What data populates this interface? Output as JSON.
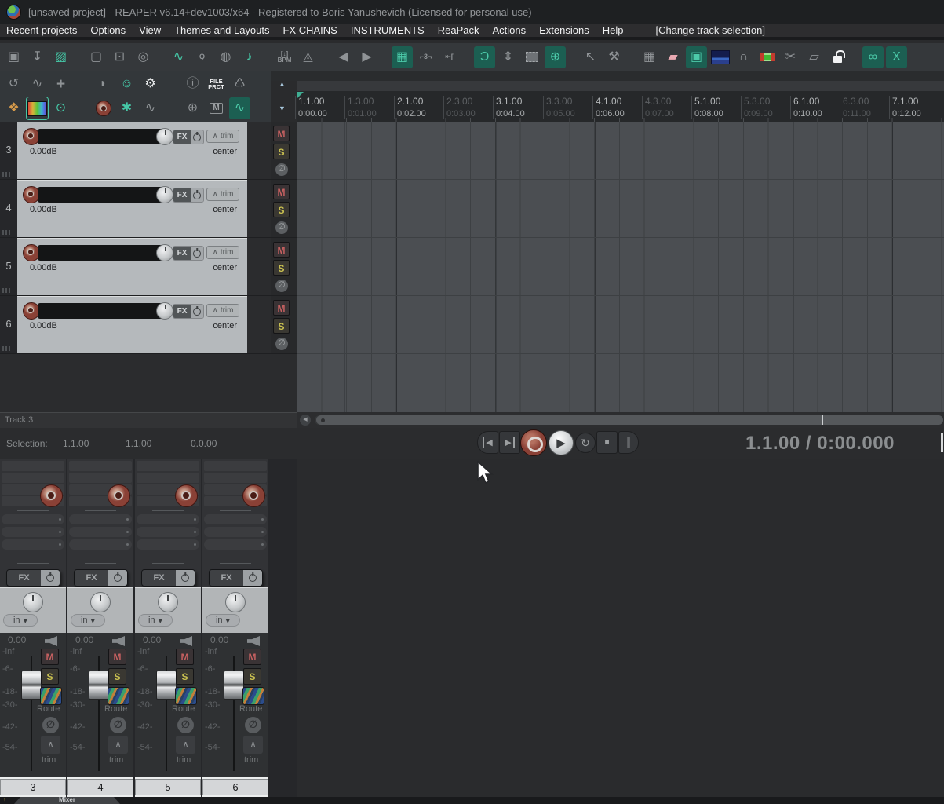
{
  "title_bar": {
    "app_icon": "reaper-logo",
    "title": "[unsaved project] - REAPER v6.14+dev1003/x64 - Registered to Boris Yanushevich (Licensed for personal use)"
  },
  "menu": {
    "items": [
      "Recent projects",
      "Options",
      "View",
      "Themes and Layouts",
      "FX CHAINS",
      "INSTRUMENTS",
      "ReaPack",
      "Actions",
      "Extensions",
      "Help"
    ],
    "extra": "[Change track selection]"
  },
  "toolbar": {
    "buttons": [
      {
        "name": "save-project",
        "glyph": "▣",
        "active": false
      },
      {
        "name": "render",
        "glyph": "↧",
        "active": false
      },
      {
        "name": "open-project",
        "glyph": "▨",
        "active": false
      },
      {
        "name": "new-project",
        "glyph": "▢",
        "active": false
      },
      {
        "name": "project-settings",
        "glyph": "⊡",
        "active": false
      },
      {
        "name": "find",
        "glyph": "◎",
        "active": false
      },
      {
        "name": "media-explorer",
        "glyph": "∿",
        "active": false
      },
      {
        "name": "quantize",
        "glyph": "Q",
        "active": false
      },
      {
        "name": "metronome-drum",
        "glyph": "◍",
        "active": false
      },
      {
        "name": "midi-editor",
        "glyph": "♪",
        "active": false
      },
      {
        "name": "bpm",
        "glyph": "[↓] BPM",
        "active": false
      },
      {
        "name": "metronome-bell",
        "glyph": "◬",
        "active": false
      },
      {
        "name": "prev-marker",
        "glyph": "◀",
        "active": false
      },
      {
        "name": "next-marker",
        "glyph": "▶",
        "active": false
      },
      {
        "name": "grid-toggle",
        "glyph": "▦",
        "active": true
      },
      {
        "name": "triplet-grid",
        "glyph": "⌐3¬",
        "active": false
      },
      {
        "name": "ripple-edit",
        "glyph": "⇤[",
        "active": false
      },
      {
        "name": "snap-toggle",
        "glyph": "Ɔ",
        "active": true
      },
      {
        "name": "zoom-vertical",
        "glyph": "⇕",
        "active": false
      },
      {
        "name": "marquee-select",
        "glyph": "",
        "active": false
      },
      {
        "name": "zoom-selection",
        "glyph": "⊕",
        "active": true
      },
      {
        "name": "mouse-pointer-mode",
        "glyph": "↖",
        "active": false
      },
      {
        "name": "hammer-edit",
        "glyph": "⚒",
        "active": false
      },
      {
        "name": "grid-settings",
        "glyph": "▦",
        "active": false
      },
      {
        "name": "envelope-item",
        "glyph": "▰",
        "active": false
      },
      {
        "name": "group-items",
        "glyph": "▣",
        "active": true
      },
      {
        "name": "theme",
        "glyph": "",
        "active": false
      },
      {
        "name": "envelope-unlink",
        "glyph": "∩",
        "active": false
      },
      {
        "name": "item-edges",
        "glyph": "",
        "active": false
      },
      {
        "name": "split-items",
        "glyph": "✂",
        "active": false
      },
      {
        "name": "new-take",
        "glyph": "▱",
        "active": false
      },
      {
        "name": "lock-toggle",
        "glyph": "",
        "active": false
      },
      {
        "name": "link-toggle",
        "glyph": "∞",
        "active": true
      },
      {
        "name": "crossfade-toggle",
        "glyph": "X",
        "active": true
      }
    ]
  },
  "tcp_toolbar": {
    "row1": [
      {
        "name": "wave-undo",
        "glyph": "↺"
      },
      {
        "name": "wave-folder",
        "glyph": "∿"
      },
      {
        "name": "add-track",
        "glyph": "+"
      },
      {
        "name": "reaper-menu",
        "glyph": "◗"
      },
      {
        "name": "actions-smiley",
        "glyph": "☺"
      },
      {
        "name": "wrench",
        "glyph": "⚙"
      },
      {
        "name": "info",
        "glyph": "ⓘ"
      },
      {
        "name": "file-protect",
        "glyph": "FILE PRCT"
      },
      {
        "name": "trash",
        "glyph": "♺"
      },
      {
        "name": "scroll-up",
        "glyph": "▲"
      }
    ],
    "row2": [
      {
        "name": "color-folder",
        "glyph": "❖"
      },
      {
        "name": "spectral-peaks",
        "glyph": ""
      },
      {
        "name": "visibility-folder",
        "glyph": "⊙"
      },
      {
        "name": "record-arm-all",
        "glyph": ""
      },
      {
        "name": "new-envelope",
        "glyph": "✱"
      },
      {
        "name": "envelope-visibility",
        "glyph": "∿"
      },
      {
        "name": "zoom-in",
        "glyph": "⊕"
      },
      {
        "name": "media-m",
        "glyph": "M"
      },
      {
        "name": "envelope-touch",
        "glyph": "∿"
      },
      {
        "name": "scroll-down",
        "glyph": "▼"
      }
    ]
  },
  "ruler": {
    "marks": [
      {
        "measure": "1.1.00",
        "time": "0:00.00",
        "major": true
      },
      {
        "measure": "1.3.00",
        "time": "0:01.00",
        "major": false
      },
      {
        "measure": "2.1.00",
        "time": "0:02.00",
        "major": true
      },
      {
        "measure": "2.3.00",
        "time": "0:03.00",
        "major": false
      },
      {
        "measure": "3.1.00",
        "time": "0:04.00",
        "major": true
      },
      {
        "measure": "3.3.00",
        "time": "0:05.00",
        "major": false
      },
      {
        "measure": "4.1.00",
        "time": "0:06.00",
        "major": true
      },
      {
        "measure": "4.3.00",
        "time": "0:07.00",
        "major": false
      },
      {
        "measure": "5.1.00",
        "time": "0:08.00",
        "major": true
      },
      {
        "measure": "5.3.00",
        "time": "0:09.00",
        "major": false
      },
      {
        "measure": "6.1.00",
        "time": "0:10.00",
        "major": true
      },
      {
        "measure": "6.3.00",
        "time": "0:11.00",
        "major": false
      },
      {
        "measure": "7.1.00",
        "time": "0:12.00",
        "major": true
      }
    ]
  },
  "track_labels": {
    "fx": "FX",
    "trim": "trim",
    "mute": "M",
    "solo": "S",
    "phase": "∅",
    "envelope": "∧"
  },
  "tracks": [
    {
      "number": "3",
      "volume_db": "0.00dB",
      "pan": "center"
    },
    {
      "number": "4",
      "volume_db": "0.00dB",
      "pan": "center"
    },
    {
      "number": "5",
      "volume_db": "0.00dB",
      "pan": "center"
    },
    {
      "number": "6",
      "volume_db": "0.00dB",
      "pan": "center"
    }
  ],
  "track_panel": {
    "selected_label": "Track 3"
  },
  "selection": {
    "label": "Selection:",
    "start": "1.1.00",
    "end": "1.1.00",
    "length": "0.0.00"
  },
  "transport": {
    "prev": "◀",
    "next": "▶",
    "play": "▶",
    "stop": "■",
    "pause": "║",
    "repeat": "↻",
    "time_display": "1.1.00 / 0:00.000"
  },
  "mixer": {
    "labels": {
      "fx": "FX",
      "route": "Route",
      "trim": "trim",
      "mute": "M",
      "solo": "S",
      "phase": "∅",
      "envelope": "∧",
      "input_arrow": "▾"
    },
    "scale": [
      "-inf",
      "-6-",
      "-18-",
      "-30-",
      "-42-",
      "-54-"
    ],
    "strips": [
      {
        "number": "3",
        "input": "in",
        "gain": "0.00"
      },
      {
        "number": "4",
        "input": "in",
        "gain": "0.00"
      },
      {
        "number": "5",
        "input": "in",
        "gain": "0.00"
      },
      {
        "number": "6",
        "input": "in",
        "gain": "0.00"
      }
    ]
  },
  "dock": {
    "warning": "!",
    "tab": "Mixer"
  },
  "colors": {
    "accent_teal": "#3fbf9f",
    "record_red": "#8a4136",
    "mute_red": "#c66060",
    "solo_yellow": "#c9c050",
    "panel_light": "#b5b9bc"
  }
}
